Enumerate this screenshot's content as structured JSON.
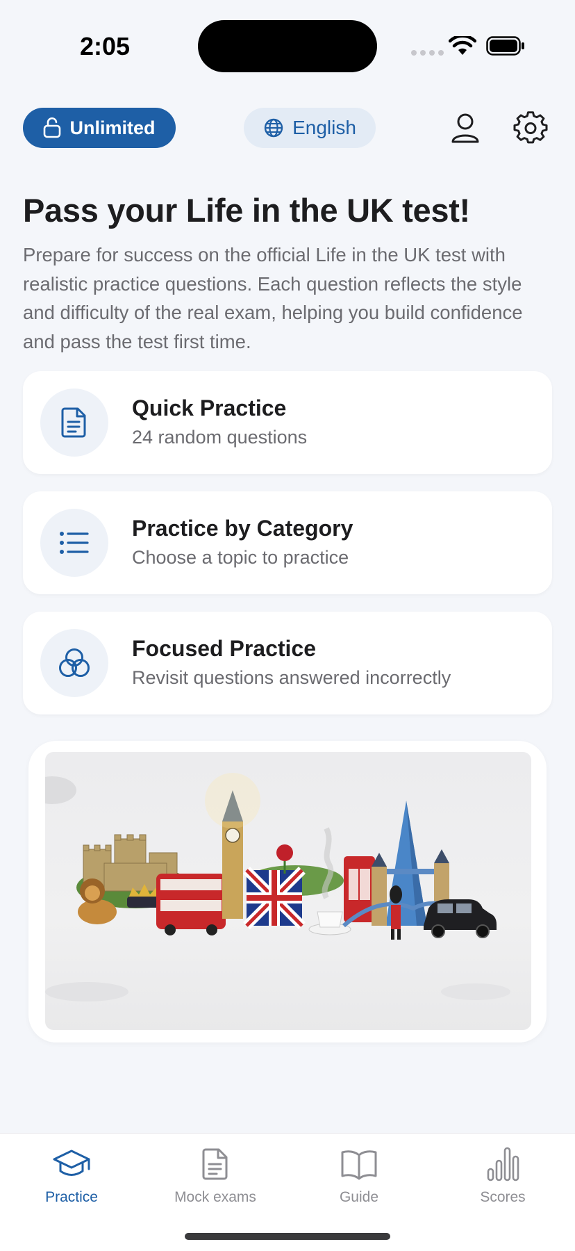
{
  "status_bar": {
    "time": "2:05"
  },
  "header": {
    "unlimited_label": "Unlimited",
    "language_label": "English"
  },
  "hero": {
    "title": "Pass your Life in the UK test!",
    "description": "Prepare for success on the official Life in the UK test with realistic practice questions. Each question reflects the style and difficulty of the real exam, helping you build confidence and pass the test first time."
  },
  "practice_options": [
    {
      "title": "Quick Practice",
      "subtitle": "24 random questions",
      "icon": "document-icon"
    },
    {
      "title": "Practice by Category",
      "subtitle": "Choose a topic to practice",
      "icon": "list-icon"
    },
    {
      "title": "Focused Practice",
      "subtitle": "Revisit questions answered incorrectly",
      "icon": "venn-circles-icon"
    }
  ],
  "tab_bar": {
    "active": "Practice",
    "tabs": [
      {
        "label": "Practice",
        "icon": "graduation-cap-icon"
      },
      {
        "label": "Mock exams",
        "icon": "document-icon"
      },
      {
        "label": "Guide",
        "icon": "book-icon"
      },
      {
        "label": "Scores",
        "icon": "bar-chart-icon"
      }
    ]
  },
  "colors": {
    "accent": "#1e5fa6",
    "background": "#f4f6fa",
    "card": "#ffffff",
    "muted_text": "#6b6b70"
  }
}
